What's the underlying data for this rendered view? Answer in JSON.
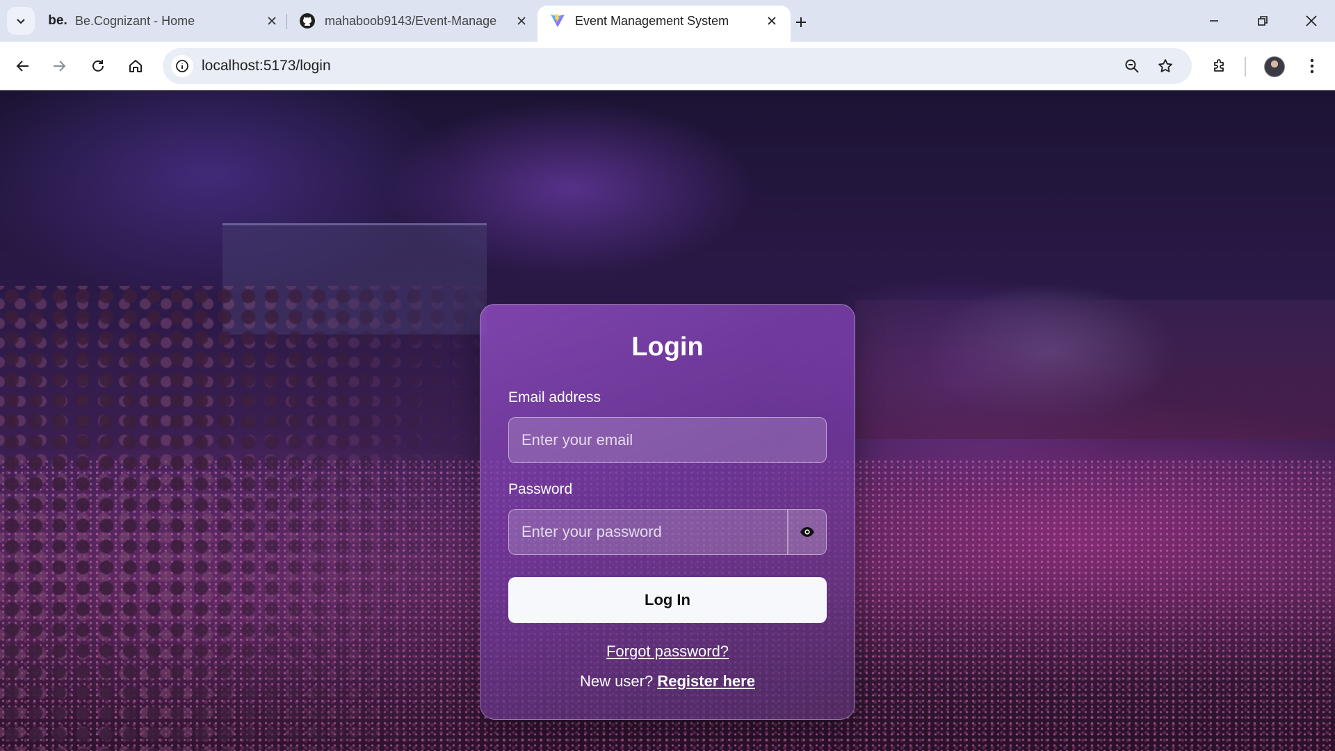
{
  "browser": {
    "tabs": [
      {
        "favicon": "be.",
        "title": "Be.Cognizant - Home",
        "active": false
      },
      {
        "favicon": "github-icon",
        "title": "mahaboob9143/Event-Manage",
        "active": false
      },
      {
        "favicon": "vite-icon",
        "title": "Event Management System",
        "active": true
      }
    ],
    "url": "localhost:5173/login"
  },
  "login": {
    "title": "Login",
    "email_label": "Email address",
    "email_placeholder": "Enter your email",
    "password_label": "Password",
    "password_placeholder": "Enter your password",
    "submit_label": "Log In",
    "forgot_label": "Forgot password?",
    "new_user_text": "New user?",
    "register_label": "Register here"
  }
}
